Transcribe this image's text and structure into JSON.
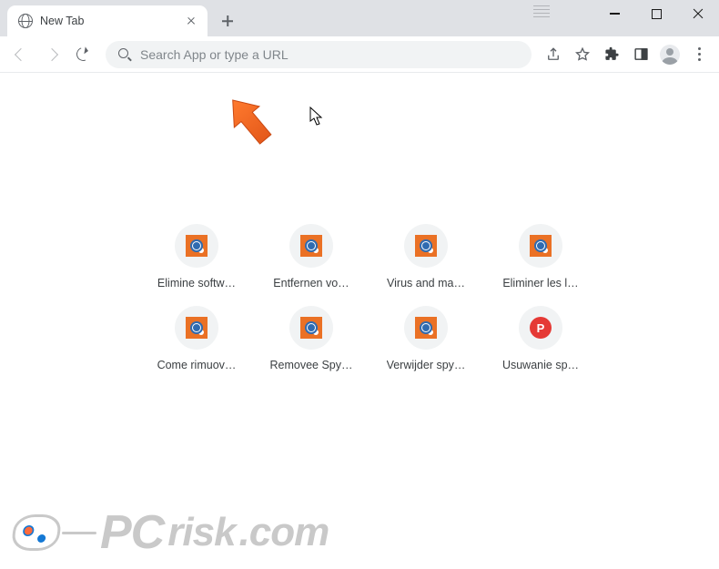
{
  "tab": {
    "title": "New Tab"
  },
  "omnibox": {
    "placeholder": "Search App or type a URL"
  },
  "shortcuts": [
    {
      "label": "Elimine softw…",
      "icon": "pcrisk"
    },
    {
      "label": "Entfernen vo…",
      "icon": "pcrisk"
    },
    {
      "label": "Virus and ma…",
      "icon": "pcrisk"
    },
    {
      "label": "Eliminer les l…",
      "icon": "pcrisk"
    },
    {
      "label": "Come rimuov…",
      "icon": "pcrisk"
    },
    {
      "label": "Removee Spy…",
      "icon": "pcrisk"
    },
    {
      "label": "Verwijder spy…",
      "icon": "pcrisk"
    },
    {
      "label": "Usuwanie sp…",
      "icon": "p-letter",
      "letter": "P"
    }
  ],
  "watermark": {
    "brand_pc": "PC",
    "brand_risk": "risk",
    "tld": ".com"
  }
}
